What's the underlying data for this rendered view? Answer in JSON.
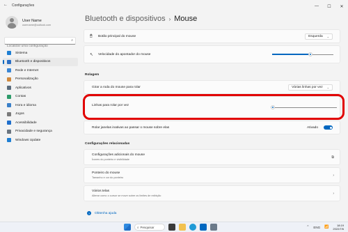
{
  "window": {
    "title": "Configurações",
    "controls": [
      "—",
      "☐",
      "✕"
    ]
  },
  "sidebar": {
    "user_name": "User Name",
    "user_email": "username@outlook.com",
    "search_placeholder": "Localizar uma configuração",
    "items": [
      {
        "label": "Sistema",
        "icon": "monitor-icon",
        "color": "#1f7fd3"
      },
      {
        "label": "Bluetooth e dispositivos",
        "icon": "bluetooth-icon",
        "color": "#2b6fc4",
        "active": true
      },
      {
        "label": "Rede e Internet",
        "icon": "wifi-icon",
        "color": "#3a86d4"
      },
      {
        "label": "Personalização",
        "icon": "brush-icon",
        "color": "#d08a3e"
      },
      {
        "label": "Aplicativos",
        "icon": "apps-icon",
        "color": "#5a6b7b"
      },
      {
        "label": "Contas",
        "icon": "person-icon",
        "color": "#2e9b6a"
      },
      {
        "label": "Hora e idioma",
        "icon": "globe-clock-icon",
        "color": "#3a7fc8"
      },
      {
        "label": "Jogos",
        "icon": "gamepad-icon",
        "color": "#7a7a7a"
      },
      {
        "label": "Acessibilidade",
        "icon": "accessibility-icon",
        "color": "#1f6fcc"
      },
      {
        "label": "Privacidade e segurança",
        "icon": "shield-icon",
        "color": "#6b7580"
      },
      {
        "label": "Windows Update",
        "icon": "update-icon",
        "color": "#1f7fd3"
      }
    ]
  },
  "main": {
    "breadcrumb_parent": "Bluetooth e dispositivos",
    "breadcrumb_separator": "›",
    "breadcrumb_current": "Mouse",
    "primary_button": {
      "label": "Botão principal do mouse",
      "value": "Esquerda"
    },
    "pointer_speed": {
      "label": "Velocidade do apontador do mouse",
      "level": 0.62
    },
    "scroll_section": "Rolagem",
    "scroll_mode": {
      "label": "Girar a roda do mouse para rolar",
      "value": "Várias linhas por vez"
    },
    "lines_per_scroll": {
      "label": "Linhas para rolar por vez",
      "level": 0.03
    },
    "inactive_scroll": {
      "label": "Rolar janelas inativas ao passar o mouse sobre elas",
      "state": "Ativado"
    },
    "related_section": "Configurações relacionadas",
    "related": [
      {
        "title": "Configurações adicionais do mouse",
        "sub": "Ícones do ponteiro e visibilidade",
        "icon": "external-link-icon"
      },
      {
        "title": "Ponteiro do mouse",
        "sub": "Tamanho e cor do ponteiro",
        "icon": "chevron-right-icon"
      },
      {
        "title": "Vários telas",
        "sub": "Alterar como o cursor se move sobre os limites de exibição",
        "icon": "chevron-right-icon"
      }
    ],
    "help": "Obtenha ajuda"
  },
  "taskbar": {
    "search_label": "Pesquisar",
    "language": "ENG",
    "time": "18:19",
    "date": "2022/7/6",
    "accent": "#0067c0"
  },
  "colors": {
    "accent": "#0067c0",
    "highlight": "#e10000"
  }
}
